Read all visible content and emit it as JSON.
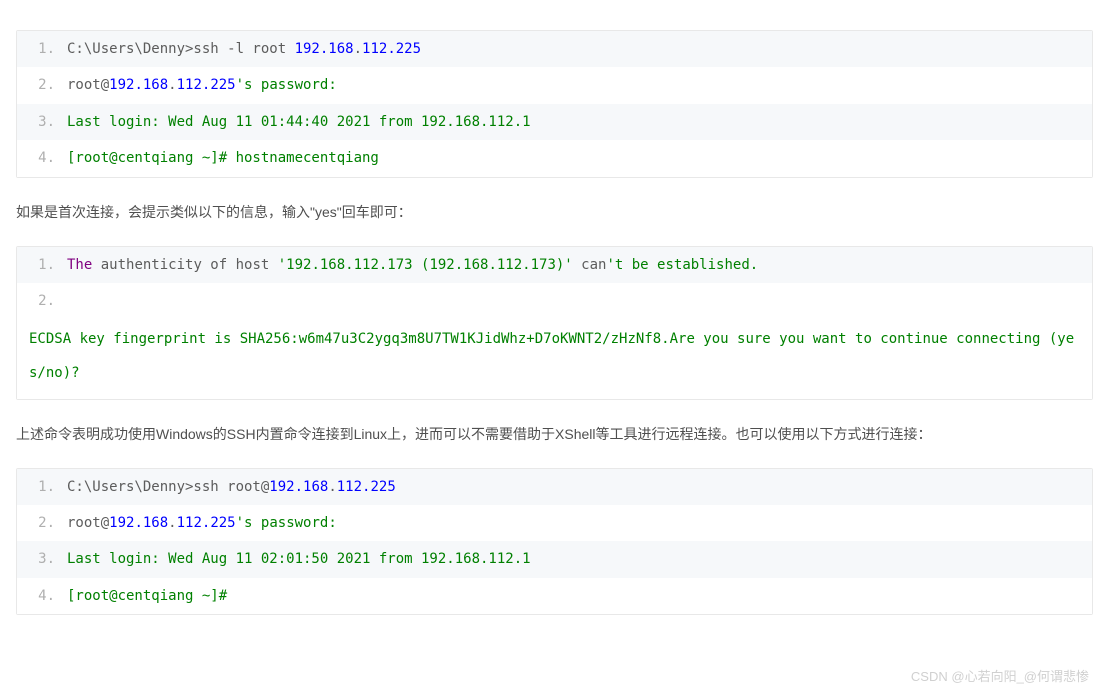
{
  "block1": {
    "lines": [
      {
        "n": "1.",
        "segs": [
          {
            "t": "C:\\Users\\Denny>ssh -l root ",
            "c": "c-gray"
          },
          {
            "t": "192.168",
            "c": "c-num"
          },
          {
            "t": ".",
            "c": "c-gray"
          },
          {
            "t": "112.225",
            "c": "c-num"
          }
        ]
      },
      {
        "n": "2.",
        "segs": [
          {
            "t": "root@",
            "c": "c-gray"
          },
          {
            "t": "192.168",
            "c": "c-num"
          },
          {
            "t": ".",
            "c": "c-gray"
          },
          {
            "t": "112.225",
            "c": "c-num"
          },
          {
            "t": "'s password:",
            "c": "c-green"
          }
        ]
      },
      {
        "n": "3.",
        "segs": [
          {
            "t": "Last login: Wed Aug 11 01:44:40 2021 from 192.168.112.1",
            "c": "c-green"
          }
        ]
      },
      {
        "n": "4.",
        "segs": [
          {
            "t": "[root@centqiang ~]# hostnamecentqiang",
            "c": "c-green"
          }
        ]
      }
    ]
  },
  "para1": "如果是首次连接，会提示类似以下的信息，输入\"yes\"回车即可：",
  "block2": {
    "lines": [
      {
        "n": "1.",
        "segs": [
          {
            "t": "The",
            "c": "c-purple"
          },
          {
            "t": " authenticity of host ",
            "c": "c-gray"
          },
          {
            "t": "'192.168.112.173 (192.168.112.173)'",
            "c": "c-green"
          },
          {
            "t": " can",
            "c": "c-gray"
          },
          {
            "t": "'t be established.",
            "c": "c-green"
          }
        ]
      },
      {
        "n": "2.",
        "segs": []
      }
    ],
    "cont": "ECDSA key fingerprint is SHA256:w6m47u3C2ygq3m8U7TW1KJidWhz+D7oKWNT2/zHzNf8.Are you sure you want to continue connecting (yes/no)?"
  },
  "para2": "上述命令表明成功使用Windows的SSH内置命令连接到Linux上，进而可以不需要借助于XShell等工具进行远程连接。也可以使用以下方式进行连接：",
  "block3": {
    "lines": [
      {
        "n": "1.",
        "segs": [
          {
            "t": "C:\\Users\\Denny>ssh root@",
            "c": "c-gray"
          },
          {
            "t": "192.168",
            "c": "c-num"
          },
          {
            "t": ".",
            "c": "c-gray"
          },
          {
            "t": "112.225",
            "c": "c-num"
          }
        ]
      },
      {
        "n": "2.",
        "segs": [
          {
            "t": "root@",
            "c": "c-gray"
          },
          {
            "t": "192.168",
            "c": "c-num"
          },
          {
            "t": ".",
            "c": "c-gray"
          },
          {
            "t": "112.225",
            "c": "c-num"
          },
          {
            "t": "'s password:",
            "c": "c-green"
          }
        ]
      },
      {
        "n": "3.",
        "segs": [
          {
            "t": "Last login: Wed Aug 11 02:01:50 2021 from 192.168.112.1",
            "c": "c-green"
          }
        ]
      },
      {
        "n": "4.",
        "segs": [
          {
            "t": "[root@centqiang ~]#",
            "c": "c-green"
          }
        ]
      }
    ]
  },
  "watermark": "CSDN @心若向阳_@何谓悲惨"
}
